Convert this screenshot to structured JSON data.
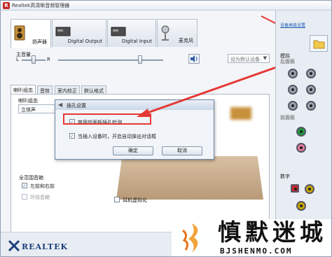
{
  "window": {
    "title": "Realtek高清晰音频管理器"
  },
  "device_tabs": [
    {
      "label": "扬声器",
      "icon": "speaker-icon",
      "active": true
    },
    {
      "label": "Digital Output",
      "icon": "digital-device-icon",
      "active": false
    },
    {
      "label": "Digital Input",
      "icon": "digital-device-icon",
      "active": false
    },
    {
      "label": "麦克风",
      "icon": "microphone-icon",
      "active": false
    }
  ],
  "volume": {
    "label": "主音量",
    "left": "L",
    "right": "R",
    "default_device": "设为默认设备"
  },
  "sub_tabs": [
    "喇叭组态",
    "音效",
    "室内校正",
    "默认格式"
  ],
  "speaker_config": {
    "label": "喇叭组态",
    "value": "立体声"
  },
  "full_range": {
    "heading": "全范围音箱",
    "front_lr": "左前和右前",
    "surround": "环绕音箱"
  },
  "virtualization": "耳机虚拟化",
  "dialog": {
    "title": "插孔设置",
    "option1": "禁用前面板插孔检测",
    "option2": "当插入设备时，开启自动弹出对话框",
    "ok": "确定",
    "cancel": "取消"
  },
  "right_pane": {
    "link": "设备高级设置",
    "analog": "模拟",
    "rear_panel": "后面板",
    "front_panel": "前面板",
    "digital": "数字"
  },
  "brand": "REALTEK",
  "watermark": {
    "title": "慎默迷城",
    "url": "BJSHENMO.COM"
  },
  "colors": {
    "accent_red": "#e53935",
    "link_blue": "#1b5ab6",
    "jack_gray": "#9aa3ad",
    "jack_green": "#1f9a3a",
    "jack_pink": "#e27a9a"
  }
}
